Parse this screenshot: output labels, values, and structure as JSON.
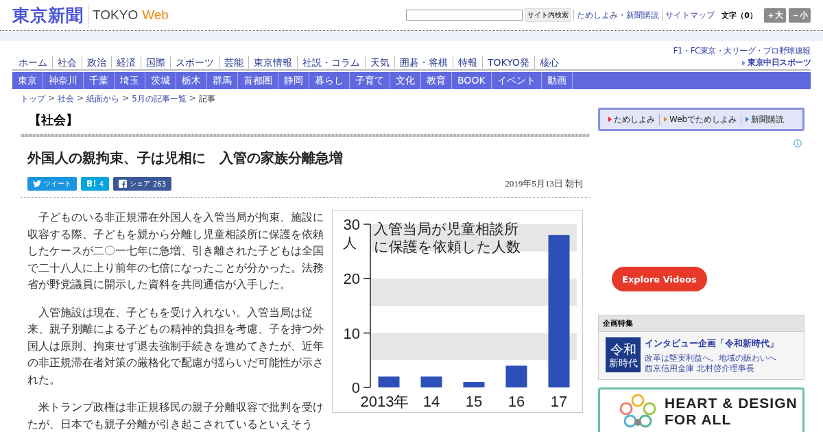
{
  "header": {
    "logo": "東京新聞",
    "brand": "TOKYO",
    "brand_accent": "Web",
    "search_button": "サイト内検索",
    "links": [
      "ためしよみ・新聞購読",
      "サイトマップ"
    ],
    "font_label": "文字（0）",
    "font_buttons": [
      "＋大",
      "－小"
    ]
  },
  "nav": {
    "items": [
      "ホーム",
      "社会",
      "政治",
      "経済",
      "国際",
      "スポーツ",
      "芸能",
      "東京情報",
      "社説・コラム",
      "天気",
      "囲碁・将棋",
      "特報",
      "TOKYO発",
      "核心"
    ]
  },
  "sports": {
    "caption": "F1・FC東京・大リーグ・プロ野球速報",
    "logo": "東京中日スポーツ"
  },
  "subnav": {
    "items": [
      "東京",
      "神奈川",
      "千葉",
      "埼玉",
      "茨城",
      "栃木",
      "群馬",
      "首都圏",
      "静岡",
      "暮らし",
      "子育て",
      "文化",
      "教育",
      "BOOK",
      "イベント",
      "動画"
    ]
  },
  "breadcrumb": {
    "separator": ">",
    "items": [
      {
        "label": "トップ",
        "link": true
      },
      {
        "label": "社会",
        "link": true
      },
      {
        "label": "紙面から",
        "link": true
      },
      {
        "label": "5月の記事一覧",
        "link": true
      },
      {
        "label": "記事",
        "link": false
      }
    ]
  },
  "article": {
    "section": "【社会】",
    "title": "外国人の親拘束、子は児相に　入管の家族分離急増",
    "share": [
      {
        "kind": "tweet",
        "label": "ツイート"
      },
      {
        "kind": "hatena",
        "label": "B!",
        "count": "4"
      },
      {
        "kind": "facebook",
        "label": "シェア",
        "count": "263"
      }
    ],
    "date": "2019年5月13日 朝刊",
    "paragraphs": [
      "子どものいる非正規滞在外国人を入管当局が拘束、施設に収容する際、子どもを親から分離し児童相談所に保護を依頼したケースが二〇一七年に急増、引き離された子どもは全国で二十八人に上り前年の七倍になったことが分かった。法務省が野党議員に開示した資料を共同通信が入手した。",
      "入管施設は現在、子どもを受け入れない。入管当局は従来、親子別離による子どもの精神的負担を考慮、子を持つ外国人は原則、拘束せず退去強制手続きを進めてきたが、近年の非正規滞在者対策の厳格化で配慮が揺らいだ可能性が示された。",
      "米トランプ政権は非正規移民の親子分離収容で批判を受けたが、日本でも親子分離が引き起こされているといえそう"
    ],
    "chart_data": {
      "type": "bar",
      "title": "入管当局が児童相談所に保護を依頼した人数",
      "ylabel": "人",
      "categories": [
        "2013年",
        "14",
        "15",
        "16",
        "17"
      ],
      "series": [
        {
          "color": "#2d4fb8",
          "values": [
            2,
            2,
            1,
            4,
            28
          ]
        }
      ],
      "ylim": [
        0,
        30
      ],
      "yticks": [
        0,
        10,
        20,
        30
      ]
    }
  },
  "sidebar": {
    "promo": [
      {
        "label": "ためしよみ",
        "color": "#e8262d"
      },
      {
        "label": "Webでためしよみ",
        "color": "#f08a2c"
      },
      {
        "label": "新聞購読",
        "color": "#2a7fe0"
      }
    ],
    "video_button": "Explore Videos",
    "feature": {
      "heading": "企画特集",
      "thumb": [
        "令和",
        "新時代"
      ],
      "title": "インタビュー企画「令和新時代」",
      "lines": [
        "改革は堅実利益へ。地域の賑わいへ",
        "西京信用金庫 北村啓介理事長"
      ]
    },
    "banner": {
      "lines": [
        "HEART & DESIGN",
        "FOR ALL"
      ]
    }
  }
}
